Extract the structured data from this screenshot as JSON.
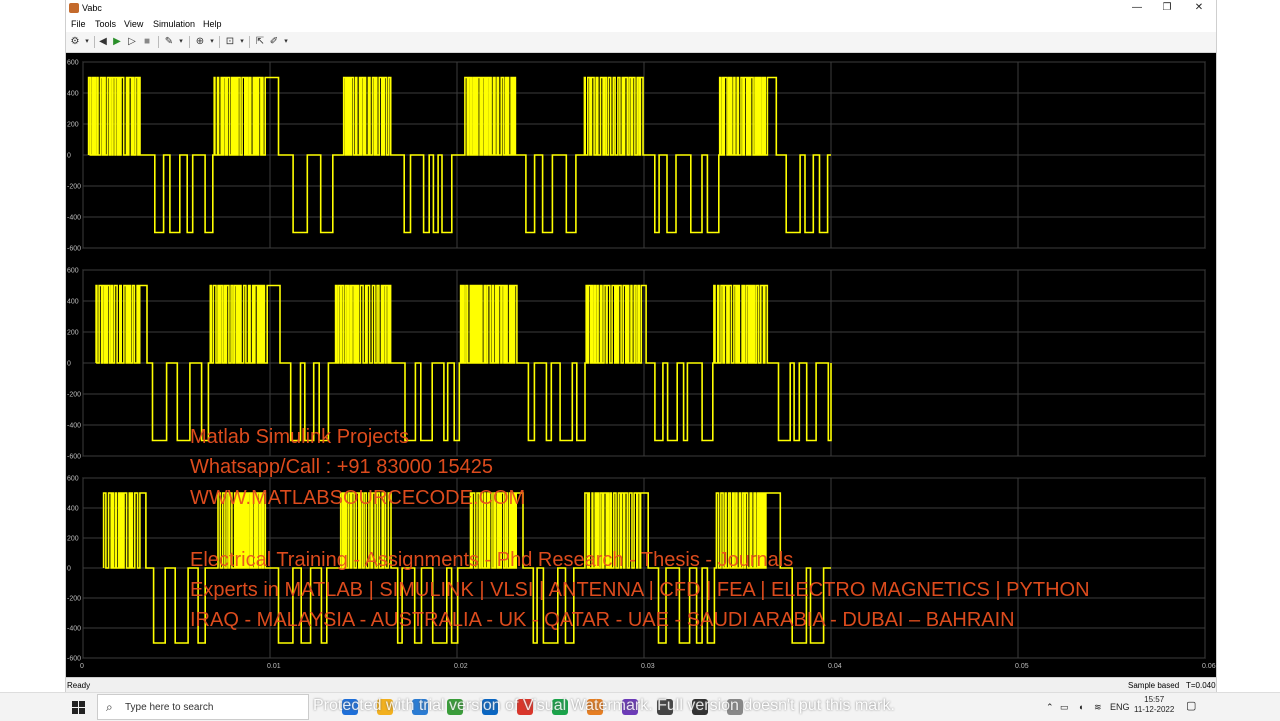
{
  "window": {
    "title": "Vabc",
    "minimize": "—",
    "maximize": "❐",
    "close": "✕"
  },
  "menu": [
    "File",
    "Tools",
    "View",
    "Simulation",
    "Help"
  ],
  "toolbar": {
    "icons": [
      "settings-icon",
      "back-step-icon",
      "run-icon",
      "step-forward-icon",
      "stop-icon",
      "highlight-icon",
      "zoom-icon",
      "fit-icon",
      "cursor-icon",
      "style-icon"
    ]
  },
  "chart_data": [
    {
      "type": "line",
      "ylim": [
        -600,
        600
      ],
      "yticks": [
        "600",
        "400",
        "200",
        "0",
        "-200",
        "-400",
        "-600"
      ],
      "series_color": "#ffff00",
      "levels": [
        500,
        0,
        -500
      ]
    },
    {
      "type": "line",
      "ylim": [
        -600,
        600
      ],
      "yticks": [
        "600",
        "400",
        "200",
        "0",
        "-200",
        "-400",
        "-600"
      ],
      "series_color": "#ffff00",
      "levels": [
        500,
        0,
        -500
      ]
    },
    {
      "type": "line",
      "ylim": [
        -600,
        600
      ],
      "yticks": [
        "600",
        "400",
        "200",
        "0",
        "-200",
        "-400",
        "-600"
      ],
      "series_color": "#ffff00",
      "levels": [
        500,
        0,
        -500
      ],
      "xlim": [
        0,
        0.06
      ],
      "xticks": [
        "0",
        "0.01",
        "0.02",
        "0.03",
        "0.04",
        "0.05",
        "0.06"
      ]
    }
  ],
  "signal": {
    "end_time": 0.04
  },
  "status": {
    "ready": "Ready",
    "mode": "Sample based",
    "time": "T=0.040"
  },
  "watermark": {
    "line1": "Matlab Simulink Projects",
    "line2": "Whatsapp/Call : +91 83000 15425",
    "line3": "WWW.MATLABSOURCECODE.COM",
    "line4": "Electrical Training - Assignments - Phd Research - Thesis - Journals",
    "line5": "Experts in MATLAB | SIMULINK | VLSI | ANTENNA | CFD | FEA | ELECTRO MAGNETICS | PYTHON",
    "line6": "IRAQ - MALAYSIA - AUSTRALIA - UK - QATAR - UAE - SAUDI ARABIA - DUBAI – BAHRAIN"
  },
  "protect_notice": "Protected with trial version of Visual Watermark. Full version doesn't put this mark.",
  "taskbar": {
    "search_placeholder": "Type here to search",
    "lang": "ENG",
    "time": "15:57",
    "date": "11-12-2022",
    "app_colors": [
      "#1e6fd9",
      "#f2b01e",
      "#2b7cd3",
      "#3a9d3a",
      "#0a66c2",
      "#d9362b",
      "#1aa34a",
      "#e67e22",
      "#6c3bb8",
      "#444444",
      "#333333",
      "#888888"
    ]
  }
}
